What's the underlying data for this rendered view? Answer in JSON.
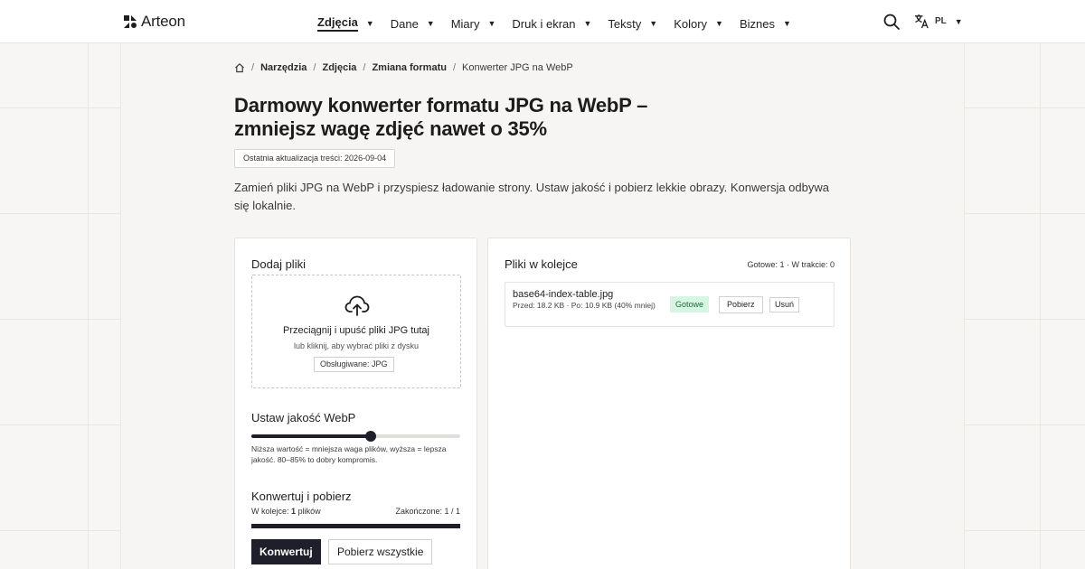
{
  "header": {
    "brand": "Arteon",
    "nav": [
      {
        "label": "Zdjęcia",
        "active": true
      },
      {
        "label": "Dane"
      },
      {
        "label": "Miary"
      },
      {
        "label": "Druk i ekran"
      },
      {
        "label": "Teksty"
      },
      {
        "label": "Kolory"
      },
      {
        "label": "Biznes"
      }
    ],
    "lang": "PL"
  },
  "breadcrumb": {
    "items": [
      "Narzędzia",
      "Zdjęcia",
      "Zmiana formatu"
    ],
    "current": "Konwerter JPG na WebP"
  },
  "page": {
    "title": "Darmowy konwerter formatu JPG na WebP – zmniejsz wagę zdjęć nawet o 35%",
    "updated": "Ostatnia aktualizacja treści: 2026-09-04",
    "lead": "Zamień pliki JPG na WebP i przyspiesz ładowanie strony. Ustaw jakość i pobierz lekkie obrazy. Konwersja odbywa się lokalnie."
  },
  "upload": {
    "heading": "Dodaj pliki",
    "drop_main": "Przeciągnij i upuść pliki JPG tutaj",
    "drop_sub": "lub kliknij, aby wybrać pliki z dysku",
    "supported": "Obsługiwane: JPG"
  },
  "quality": {
    "heading": "Ustaw jakość WebP",
    "value_fraction": 0.57,
    "help": "Niższa wartość = mniejsza waga plików, wyższa = lepsza jakość. 80–85% to dobry kompromis."
  },
  "convert": {
    "heading": "Konwertuj i pobierz",
    "queue_prefix": "W kolejce:",
    "queue_count": "1",
    "queue_suffix": "plików",
    "done_text": "Zakończone: 1 / 1",
    "progress_fraction": 1.0,
    "convert_label": "Konwertuj",
    "download_all_label": "Pobierz wszystkie"
  },
  "queue": {
    "heading": "Pliki w kolejce",
    "status": "Gotowe: 1 · W trakcie: 0",
    "files": [
      {
        "name": "base64-index-table.jpg",
        "meta": "Przed: 18.2 KB · Po: 10.9 KB (40% mniej)",
        "status": "Gotowe",
        "download": "Pobierz",
        "remove": "Usuń"
      }
    ]
  },
  "colors": {
    "accent": "#1f1f2b",
    "success_bg": "#d6f5e3",
    "success_text": "#1d6b3f"
  }
}
